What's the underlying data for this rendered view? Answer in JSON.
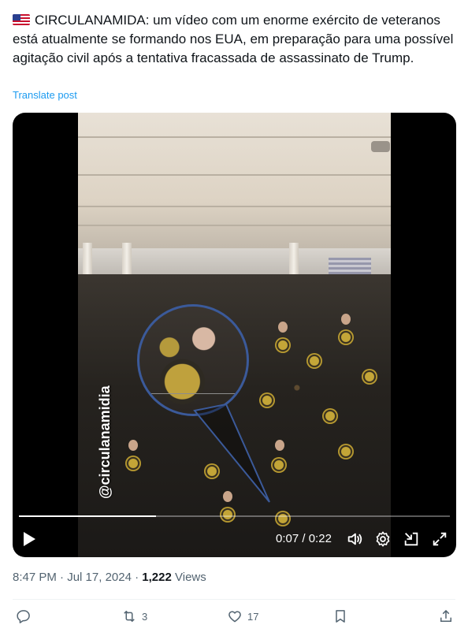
{
  "post": {
    "flag_icon": "us-flag-icon",
    "text": "CIRCULANAMIDA: um vídeo com um  enorme exército de veteranos está atualmente se formando nos EUA, em preparação para uma possível agitação civil após a tentativa fracassada de assassinato de Trump.",
    "translate_label": "Translate post"
  },
  "video": {
    "watermark": "@circulanamidia",
    "progress": 0.318,
    "current_time": "0:07",
    "separator": " / ",
    "duration": "0:22",
    "controls": [
      "play-icon",
      "volume-icon",
      "settings-icon",
      "collapse-icon",
      "fullscreen-icon"
    ]
  },
  "meta": {
    "time": "8:47 PM",
    "dot1": " · ",
    "date": "Jul 17, 2024",
    "dot2": " · ",
    "views_count": "1,222",
    "views_label": " Views"
  },
  "actions": {
    "reply_count": "",
    "repost_count": "3",
    "like_count": "17",
    "bookmark_count": ""
  },
  "colors": {
    "link": "#1d9bf0",
    "text": "#0f1419",
    "secondary": "#536471",
    "zoom_ring": "#3b5a9a"
  }
}
